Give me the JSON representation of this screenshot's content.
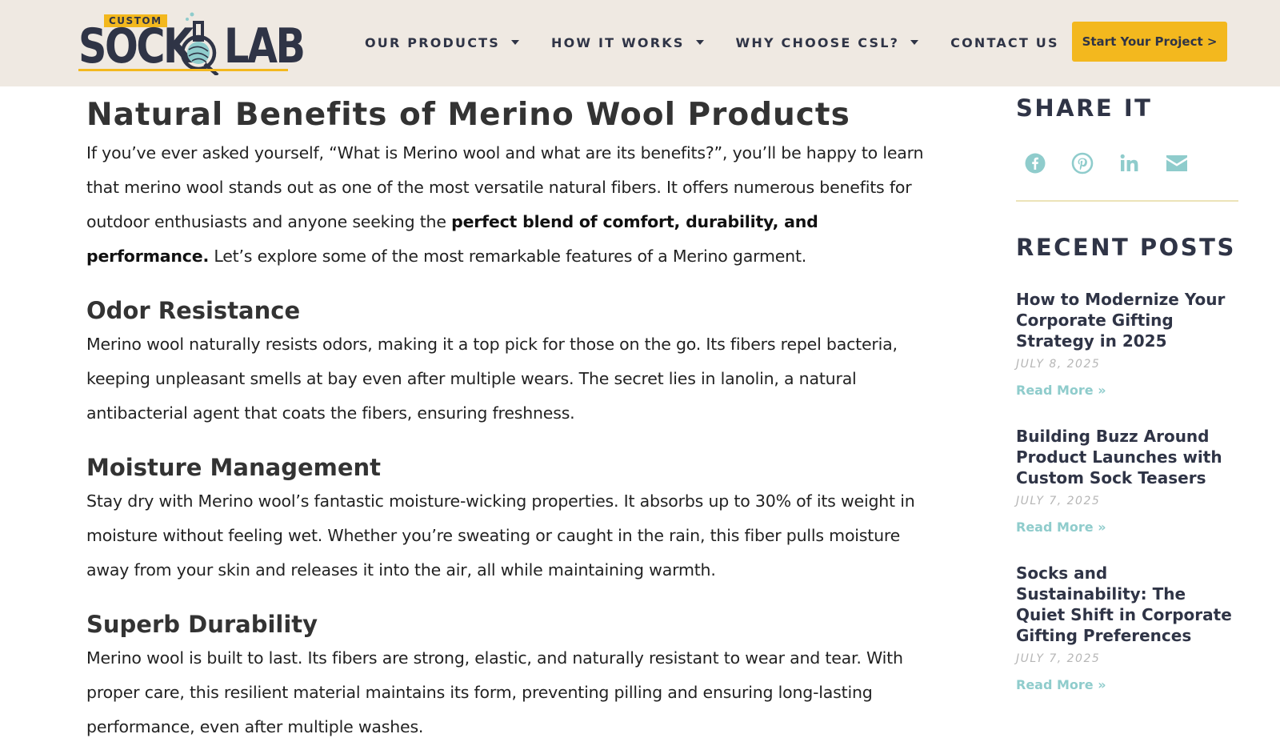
{
  "brand": {
    "tag": "CUSTOM",
    "word_left": "SOCK",
    "word_right": "LAB",
    "colors": {
      "navy": "#2f3446",
      "gold": "#f3b81e",
      "teal": "#8fcccc",
      "header_bg": "#efe9e2"
    }
  },
  "nav": {
    "items": [
      {
        "label": "OUR PRODUCTS",
        "has_dropdown": true
      },
      {
        "label": "HOW IT WORKS",
        "has_dropdown": true
      },
      {
        "label": "WHY CHOOSE CSL?",
        "has_dropdown": true
      },
      {
        "label": "CONTACT US",
        "has_dropdown": false
      }
    ],
    "cta_label": "Start Your Project >"
  },
  "article": {
    "title": "Natural Benefits of Merino Wool Products",
    "intro": {
      "before": "If you’ve ever asked yourself, “What is Merino wool and what are its benefits?”, you’ll be happy to learn that merino wool stands out as one of the most versatile natural fibers. It offers numerous benefits for outdoor enthusiasts and anyone seeking the ",
      "bold": "perfect blend of comfort, durability, and performance.",
      "after": " Let’s explore some of the most remarkable features of a Merino garment."
    },
    "sections": [
      {
        "heading": "Odor Resistance",
        "body": "Merino wool naturally resists odors, making it a top pick for those on the go. Its fibers repel bacteria, keeping unpleasant smells at bay even after multiple wears. The secret lies in lanolin, a natural antibacterial agent that coats the fibers, ensuring freshness."
      },
      {
        "heading": "Moisture Management",
        "body": "Stay dry with Merino wool’s fantastic moisture-wicking properties. It absorbs up to 30% of its weight in moisture without feeling wet. Whether you’re sweating or caught in the rain, this fiber pulls moisture away from your skin and releases it into the air, all while maintaining warmth."
      },
      {
        "heading": "Superb Durability",
        "body": "Merino wool is built to last. Its fibers are strong, elastic, and naturally resistant to wear and tear. With proper care, this resilient material maintains its form, preventing pilling and ensuring long-lasting performance, even after multiple washes."
      }
    ]
  },
  "sidebar": {
    "share_heading": "SHARE IT",
    "share_icons": [
      "facebook-icon",
      "pinterest-icon",
      "linkedin-icon",
      "email-icon"
    ],
    "recent_heading": "RECENT POSTS",
    "posts": [
      {
        "title": "How to Modernize Your Corporate Gifting Strategy in 2025",
        "date": "JULY 8, 2025",
        "read_more": "Read More »"
      },
      {
        "title": "Building Buzz Around Product Launches with Custom Sock Teasers",
        "date": "JULY 7, 2025",
        "read_more": "Read More »"
      },
      {
        "title": "Socks and Sustainability: The Quiet Shift in Corporate Gifting Preferences",
        "date": "JULY 7, 2025",
        "read_more": "Read More »"
      }
    ]
  }
}
